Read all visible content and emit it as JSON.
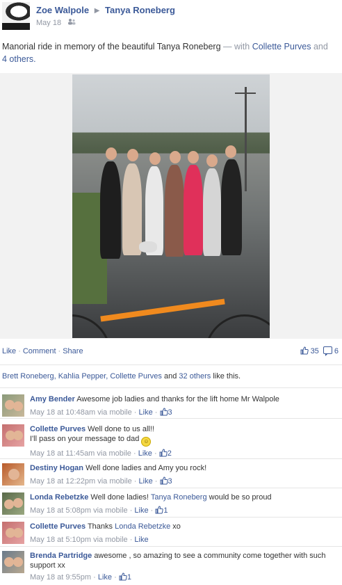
{
  "post": {
    "author": "Zoe Walpole",
    "target": "Tanya Roneberg",
    "date": "May 18",
    "audience_icon": "people-icon",
    "text_main": "Manorial ride in memory of the beautiful Tanya Roneberg",
    "text_with_sep": "— with",
    "text_with_person": "Collette Purves",
    "text_and": "and",
    "text_others": "4 others."
  },
  "actions": {
    "like": "Like",
    "comment": "Comment",
    "share": "Share",
    "separator": "·",
    "like_count": "35",
    "comment_count": "6"
  },
  "likes_summary": {
    "names": "Brett Roneberg, Kahlia Pepper, Collette Purves",
    "and": "and",
    "others": "32 others",
    "suffix": "like this."
  },
  "comments": [
    {
      "name": "Amy Bender",
      "text": "Awesome job ladies and thanks for the lift home Mr Walpole",
      "time": "May 18 at 10:48am via mobile",
      "like": "Like",
      "likes": "3"
    },
    {
      "name": "Collette Purves",
      "text": "Well done to us all!!",
      "text2": "I'll pass on your message to dad",
      "time": "May 18 at 11:45am via mobile",
      "like": "Like",
      "likes": "2"
    },
    {
      "name": "Destiny Hogan",
      "text": "Well done ladies and Amy you rock!",
      "time": "May 18 at 12:22pm via mobile",
      "like": "Like",
      "likes": "3"
    },
    {
      "name": "Londa Rebetzke",
      "text_before": "Well done ladies!",
      "text_link": "Tanya Roneberg",
      "text_after": "would be so proud",
      "time": "May 18 at 5:08pm via mobile",
      "like": "Like",
      "likes": "1"
    },
    {
      "name": "Collette Purves",
      "text_before": "Thanks",
      "text_link": "Londa Rebetzke",
      "text_after": "xo",
      "time": "May 18 at 5:10pm via mobile",
      "like": "Like"
    },
    {
      "name": "Brenda Partridge",
      "text": "awesome , so amazing to see a community come together with such support xx",
      "time": "May 18 at 9:55pm",
      "like": "Like",
      "likes": "1"
    }
  ],
  "colors": {
    "link": "#3b5998",
    "muted": "#9197a3",
    "bike_orange": "#f08a1e"
  }
}
